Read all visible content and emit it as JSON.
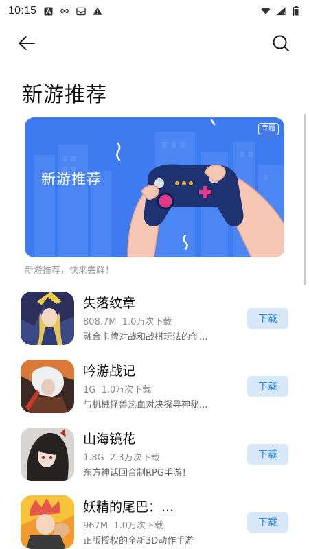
{
  "status_bar": {
    "time": "10:15",
    "left_icons": [
      "a-letter-icon",
      "infinity-icon",
      "inbox-icon",
      "alert-icon"
    ],
    "right_icons": [
      "wifi-icon",
      "signal-icon",
      "battery-icon"
    ]
  },
  "header": {
    "back_icon": "arrow-left-icon",
    "search_icon": "search-icon"
  },
  "page": {
    "title": "新游推荐"
  },
  "banner": {
    "title": "新游推荐",
    "tag": "专题",
    "caption": "新游推荐，快来尝鲜！",
    "colors": {
      "background": "#3f7bf0",
      "controller": "#1e3170"
    }
  },
  "apps": [
    {
      "name": "失落纹章",
      "size": "808.7M",
      "downloads": "1.0万次下载",
      "desc": "融合卡牌对战和战棋玩法的创...",
      "button": "下载"
    },
    {
      "name": "吟游战记",
      "size": "1G",
      "downloads": "1.0万次下载",
      "desc": "与机械怪兽热血对决探寻神秘...",
      "button": "下载"
    },
    {
      "name": "山海镜花",
      "size": "1.8G",
      "downloads": "2.3万次下载",
      "desc": "东方神话回合制RPG手游！",
      "button": "下载"
    },
    {
      "name": "妖精的尾巴：...",
      "size": "967M",
      "downloads": "1.0万次下载",
      "desc": "正版授权的全新3D动作手游",
      "button": "下载"
    }
  ],
  "colors": {
    "accent": "#2a8ae8",
    "button_bg": "#d7e8fb"
  }
}
